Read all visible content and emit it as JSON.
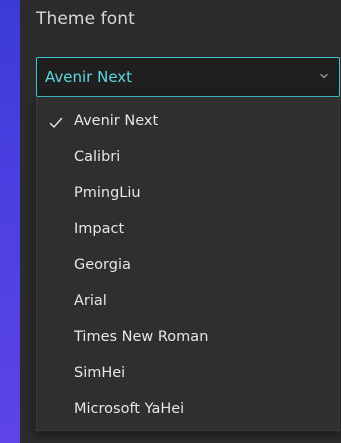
{
  "theme_font": {
    "title": "Theme font",
    "selected_value": "Avenir Next",
    "options": [
      {
        "label": "Avenir Next",
        "selected": true
      },
      {
        "label": "Calibri",
        "selected": false
      },
      {
        "label": "PmingLiu",
        "selected": false
      },
      {
        "label": "Impact",
        "selected": false
      },
      {
        "label": "Georgia",
        "selected": false
      },
      {
        "label": "Arial",
        "selected": false
      },
      {
        "label": "Times New Roman",
        "selected": false
      },
      {
        "label": "SimHei",
        "selected": false
      },
      {
        "label": "Microsoft YaHei",
        "selected": false
      }
    ]
  },
  "colors": {
    "accent": "#3ec7d2",
    "panel_bg": "#2b2b2b",
    "background_gradient_top": "#3b3bd6",
    "background_gradient_bottom": "#5d44e6"
  }
}
